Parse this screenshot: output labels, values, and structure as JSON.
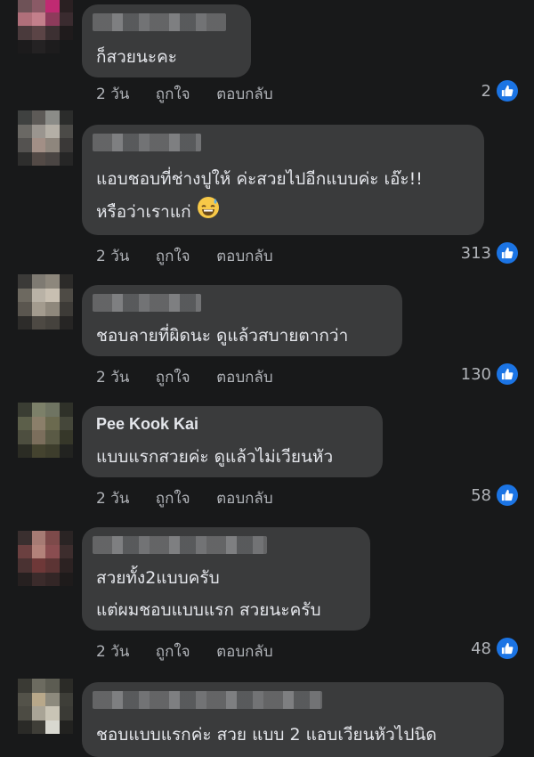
{
  "comments": [
    {
      "author": "",
      "lines": [
        "ก็สวยนะคะ"
      ],
      "time": "2 วัน",
      "like": "ถูกใจ",
      "reply": "ตอบกลับ",
      "likes": "2"
    },
    {
      "author": "",
      "lines": [
        "แอบชอบที่ช่างปูให้ ค่ะสวยไปอีกแบบค่ะ เอ๊ะ!!",
        "หรือว่าเราแก่"
      ],
      "emoji": "grinning-sweat-emoji",
      "time": "2 วัน",
      "like": "ถูกใจ",
      "reply": "ตอบกลับ",
      "likes": "313"
    },
    {
      "author": "",
      "lines": [
        "ชอบลายที่ผิดนะ ดูแล้วสบายตากว่า"
      ],
      "time": "2 วัน",
      "like": "ถูกใจ",
      "reply": "ตอบกลับ",
      "likes": "130"
    },
    {
      "author": "Pee Kook Kai",
      "lines": [
        "แบบแรกสวยค่ะ ดูแล้วไม่เวียนหัว"
      ],
      "time": "2 วัน",
      "like": "ถูกใจ",
      "reply": "ตอบกลับ",
      "likes": "58"
    },
    {
      "author": "",
      "lines": [
        "สวยทั้ง2แบบครับ",
        "แต่ผมชอบแบบแรก สวยนะครับ"
      ],
      "time": "2 วัน",
      "like": "ถูกใจ",
      "reply": "ตอบกลับ",
      "likes": "48"
    },
    {
      "author": "",
      "lines": [
        "ชอบแบบแรกค่ะ สวย แบบ 2 แอบเวียนหัวไปนิด"
      ]
    }
  ],
  "colors": {
    "background": "#18191a",
    "bubble": "#3a3b3c",
    "like_blue": "#1b74e4",
    "meta_text": "#b0b3b8"
  }
}
